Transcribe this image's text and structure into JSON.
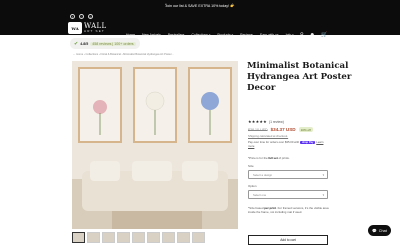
{
  "announcement": {
    "text": "Join our list & SAVE EXTRA 10% today! 👉",
    "prev_icon": "chevron-left-icon",
    "next_icon": "chevron-right-icon"
  },
  "header": {
    "logo_word1": "WALL",
    "logo_word2": "ART SET",
    "nav": [
      "Home",
      "New Arrivals",
      "Bestsellers",
      "Collections",
      "Products",
      "Reviews",
      "Earn with us",
      "Info"
    ],
    "nav_dropdowns": [
      "Collections",
      "Products",
      "Info"
    ]
  },
  "reviews_badge": {
    "score": "4.8/5",
    "count": "458 reviews | 100+ orders"
  },
  "breadcrumb": "← Home › Collections › Floral & Botanical › Minimalist Botanical Hydrangea Art Poster...",
  "product": {
    "title": "Minimalist Botanical Hydrangea Art Poster Decor",
    "stars": "★★★★★",
    "review_count": "(1 review)",
    "price_old": "$38.10 USD",
    "price_new": "$34.37 USD",
    "discount": "10% off",
    "shipping": "Shipping calculated at checkout.",
    "installments_pre": "Pay over time for orders over $35.00 with",
    "installments_brand": "shop Pay",
    "installments_link": "Learn more",
    "print_note_pre": "*Price is for the",
    "print_note_bold": "full set",
    "print_note_post": "of prints.",
    "size_label": "Size",
    "size_value": "Select a design",
    "option_label": "Option",
    "option_value": "Select one",
    "frame_note_pre": "*Size based",
    "frame_note_bold": "per print",
    "frame_note_post": ". For framed versions, it's the visible area inside the frame, not including mat if used.",
    "add_to_cart": "Add to cart"
  },
  "thumbnails_count": 9,
  "chat": {
    "label": "Chat"
  }
}
